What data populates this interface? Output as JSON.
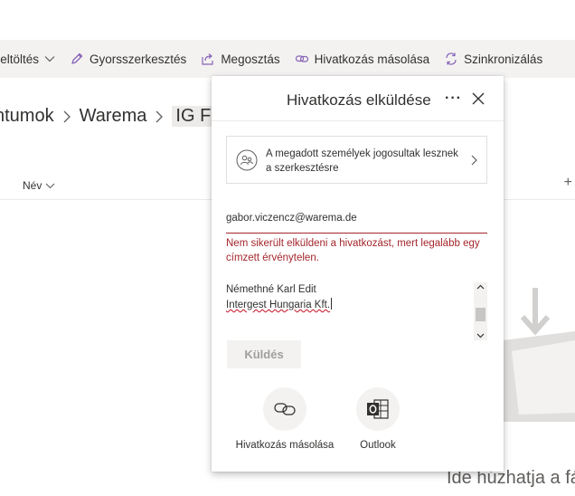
{
  "commandbar": {
    "items": [
      {
        "label": "Feltöltés",
        "icon": "upload-icon"
      },
      {
        "label": "Gyorsszerkesztés",
        "icon": "pencil-icon"
      },
      {
        "label": "Megosztás",
        "icon": "share-icon"
      },
      {
        "label": "Hivatkozás másolása",
        "icon": "link-icon"
      },
      {
        "label": "Szinkronizálás",
        "icon": "sync-icon"
      }
    ]
  },
  "breadcrumb": {
    "items": [
      "ntumok",
      "Warema",
      "IG Fl"
    ]
  },
  "list": {
    "column_name": "Név",
    "add_column": "+"
  },
  "empty_state": {
    "drop_text": "Ide húzhatja a fá"
  },
  "dialog": {
    "title": "Hivatkozás elküldése",
    "more": "···",
    "permission_text": "A megadott személyek jogosultak lesznek a szerkesztésre",
    "recipient": "gabor.viczencz@warema.de",
    "error": "Nem sikerült elküldeni a hivatkozást, mert legalább egy címzett érvénytelen.",
    "message_lines": [
      "Némethné Karl Edit",
      "Intergest Hungaria Kft."
    ],
    "send_label": "Küldés",
    "copy_link_label": "Hivatkozás másolása",
    "outlook_label": "Outlook"
  },
  "colors": {
    "error": "#a4262c",
    "command_bar_bg": "#f3f2f1",
    "disabled_text": "#a19f9d"
  }
}
